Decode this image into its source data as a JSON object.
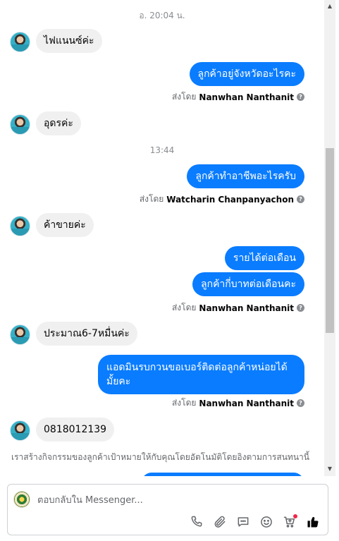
{
  "conversation": {
    "timestamps": [
      "อ. 20:04 น.",
      "13:44"
    ],
    "incoming": [
      "ไฟแนนซ์ค่ะ",
      "อุดรค่ะ",
      "ค้าขายค่ะ",
      "ประมาณ6-7หมื่นค่ะ",
      "0818012139"
    ],
    "outgoing": [
      "ลูกค้าอยู่จังหวัดอะไรคะ",
      "ลูกค้าทำอาชีพอะไรครับ",
      "รายได้ต่อเดือน",
      "ลูกค้ากี่บาทต่อเดือนคะ",
      "แอดมินรบกวนขอเบอร์ติดต่อลูกค้าหน่อยได้มั้ยคะ"
    ],
    "sent_by_prefix": "ส่งโดย",
    "senders": [
      "Nanwhan Nanthanit",
      "Watcharin Chanpanyachon",
      "Nanwhan Nanthanit",
      "Nanwhan Nanthanit"
    ],
    "help_glyph": "?",
    "notice": "เราสร้างกิจกรรมของลูกค้าเป้าหมายให้กับคุณโดยอัตโนมัติโดยอิงตามการสนทนานี้"
  },
  "scrollbar": {
    "up": "▲",
    "down": "▼"
  },
  "composer": {
    "placeholder": "ตอบกลับใน Messenger...",
    "icons": [
      "phone-icon",
      "attachment-icon",
      "saved-reply-icon",
      "emoji-icon",
      "shop-cart-icon",
      "like-icon"
    ],
    "cart_has_notification": true
  },
  "colors": {
    "outgoing_bubble": "#0a7cff",
    "incoming_bubble": "#f0f0f0",
    "notification_dot": "#f02849"
  }
}
